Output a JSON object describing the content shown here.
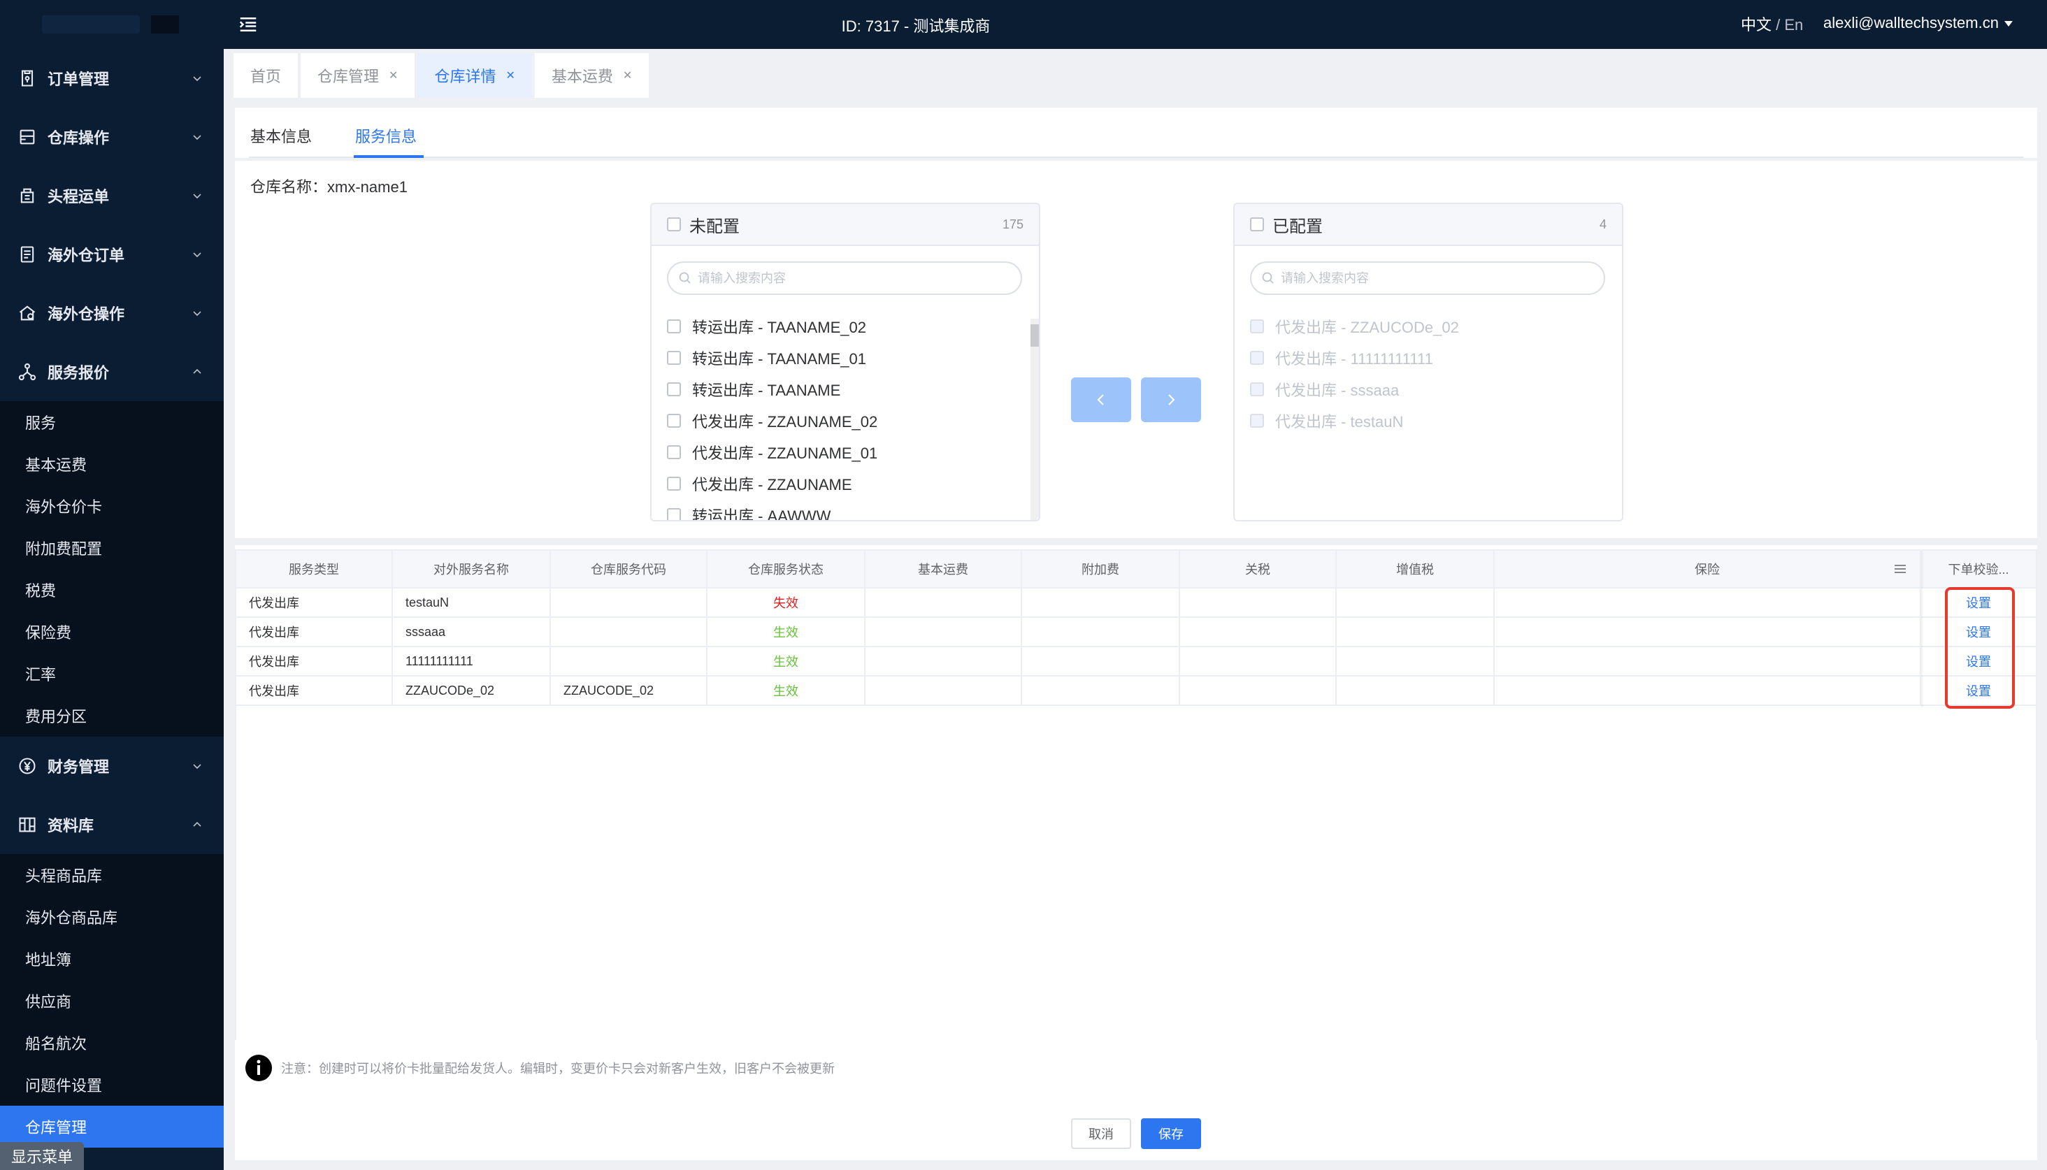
{
  "topbar": {
    "title": "ID: 7317 - 测试集成商",
    "lang_zh": "中文",
    "lang_sep": " / ",
    "lang_en": "En",
    "user_email": "alexli@walltechsystem.cn"
  },
  "sidebar": {
    "groups": [
      {
        "label": "订单管理",
        "icon": "order-icon",
        "expanded": false
      },
      {
        "label": "仓库操作",
        "icon": "warehouse-op-icon",
        "expanded": false
      },
      {
        "label": "头程运单",
        "icon": "first-leg-icon",
        "expanded": false
      },
      {
        "label": "海外仓订单",
        "icon": "overseas-order-icon",
        "expanded": false
      },
      {
        "label": "海外仓操作",
        "icon": "overseas-op-icon",
        "expanded": false
      },
      {
        "label": "服务报价",
        "icon": "service-quote-icon",
        "expanded": true
      },
      {
        "label": "财务管理",
        "icon": "yen-icon",
        "expanded": false
      },
      {
        "label": "资料库",
        "icon": "library-icon",
        "expanded": true
      }
    ],
    "service_quote_items": [
      "服务",
      "基本运费",
      "海外仓价卡",
      "附加费配置",
      "税费",
      "保险费",
      "汇率",
      "费用分区"
    ],
    "library_items": [
      "头程商品库",
      "海外仓商品库",
      "地址簿",
      "供应商",
      "船名航次",
      "问题件设置",
      "仓库管理"
    ],
    "active_item": "仓库管理",
    "show_menu": "显示菜单"
  },
  "tabs": [
    {
      "label": "首页",
      "closable": false,
      "active": false
    },
    {
      "label": "仓库管理",
      "closable": true,
      "active": false
    },
    {
      "label": "仓库详情",
      "closable": true,
      "active": true
    },
    {
      "label": "基本运费",
      "closable": true,
      "active": false
    }
  ],
  "subtabs": {
    "basic": "基本信息",
    "service": "服务信息",
    "active": "服务信息"
  },
  "warehouse": {
    "label": "仓库名称：",
    "name": "xmx-name1"
  },
  "transfer": {
    "left": {
      "title": "未配置",
      "count": "175",
      "placeholder": "请输入搜索内容",
      "items": [
        "转运出库 - TAANAME_02",
        "转运出库 - TAANAME_01",
        "转运出库 - TAANAME",
        "代发出库 - ZZAUNAME_02",
        "代发出库 - ZZAUNAME_01",
        "代发出库 - ZZAUNAME",
        "转运出库 - AAWWW"
      ]
    },
    "right": {
      "title": "已配置",
      "count": "4",
      "placeholder": "请输入搜索内容",
      "items": [
        "代发出库 - ZZAUCODe_02",
        "代发出库 - 11111111111",
        "代发出库 - sssaaa",
        "代发出库 - testauN"
      ]
    }
  },
  "table": {
    "headers": [
      "服务类型",
      "对外服务名称",
      "仓库服务代码",
      "仓库服务状态",
      "基本运费",
      "附加费",
      "关税",
      "增值税",
      "保险",
      "下单校验..."
    ],
    "rows": [
      {
        "type": "代发出库",
        "name": "testauN",
        "code": "",
        "status": "失效",
        "status_kind": "bad",
        "action": "设置"
      },
      {
        "type": "代发出库",
        "name": "sssaaa",
        "code": "",
        "status": "生效",
        "status_kind": "ok",
        "action": "设置"
      },
      {
        "type": "代发出库",
        "name": "11111111111",
        "code": "",
        "status": "生效",
        "status_kind": "ok",
        "action": "设置"
      },
      {
        "type": "代发出库",
        "name": "ZZAUCODe_02",
        "code": "ZZAUCODE_02",
        "status": "生效",
        "status_kind": "ok",
        "action": "设置"
      }
    ]
  },
  "note": "注意：创建时可以将价卡批量配给发货人。编辑时，变更价卡只会对新客户生效，旧客户不会被更新",
  "footer": {
    "cancel": "取消",
    "save": "保存"
  },
  "colors": {
    "primary": "#2d76f0",
    "sidebar_bg": "#0b1d33",
    "status_bad": "#e02020",
    "status_ok": "#67c23a",
    "highlight": "#e53b2f"
  }
}
